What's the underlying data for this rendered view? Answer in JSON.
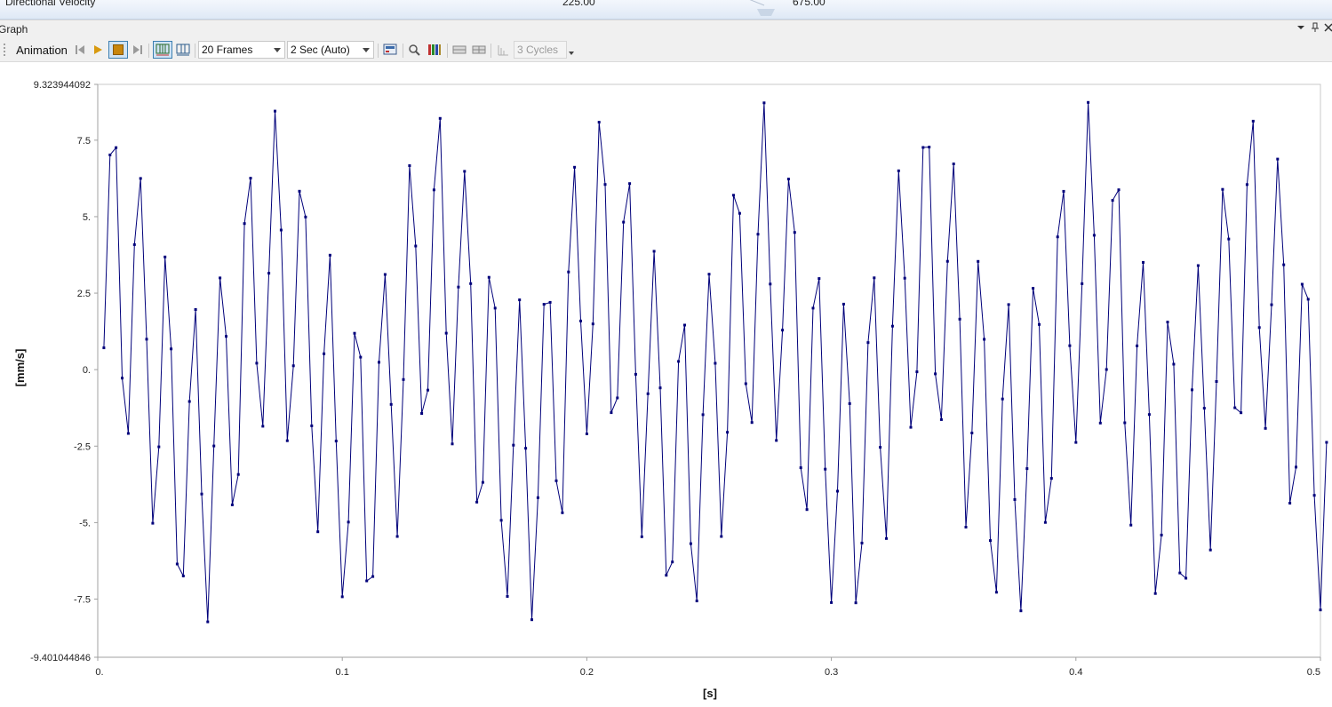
{
  "results_row": {
    "label": "Directional Velocity",
    "value_a": "225.00",
    "value_b": "675.00"
  },
  "pane": {
    "title": "Graph",
    "dropdown_icon": "chevron-down-icon",
    "pin_icon": "pin-icon",
    "close_icon": "close-icon"
  },
  "toolbar": {
    "animation_label": "Animation",
    "frames": "20 Frames",
    "duration": "2 Sec (Auto)",
    "cycles": "3 Cycles",
    "icons": [
      "previous-frame-icon",
      "play-icon",
      "stop-icon",
      "next-frame-icon",
      "distributed-frames-icon",
      "result-data-frames-icon",
      "export-video-icon",
      "zoom-icon",
      "legend-icon",
      "keep-time-icon",
      "keep-all-icon",
      "sweep-icon"
    ]
  },
  "colors": {
    "series": "#00007a",
    "axis": "#a0a0a0",
    "toolbar_bg": "#f0f0f0",
    "accent": "#3c7fb1"
  },
  "chart_data": {
    "type": "line",
    "title": "",
    "xlabel": "[s]",
    "ylabel": "[mm/s]",
    "xlim": [
      0,
      0.5
    ],
    "ylim": [
      -9.401044846,
      9.323944092
    ],
    "y_max_label": "9.323944092",
    "y_min_label": "-9.401044846",
    "x_ticks": [
      "0.",
      "0.1",
      "0.2",
      "0.3",
      "0.4",
      "0.5"
    ],
    "y_ticks": [
      "7.5",
      "5.",
      "2.5",
      "0.",
      "-2.5",
      "-5.",
      "-7.5"
    ],
    "grid": false,
    "legend": "none",
    "series": [
      {
        "point_count": 201,
        "x_start": 0.0025,
        "x_step": 0.0025,
        "components": [
          {
            "amplitude": 3.2,
            "frequency_hz": 15.0,
            "phase": 1.0
          },
          {
            "amplitude": 5.2,
            "frequency_hz": 90.2,
            "phase": -1.9
          },
          {
            "amplitude": 0.4,
            "frequency_hz": 151.0,
            "phase": 0.5
          }
        ],
        "stats": {
          "max": 9.323944092,
          "min": -9.401044846
        }
      }
    ]
  }
}
